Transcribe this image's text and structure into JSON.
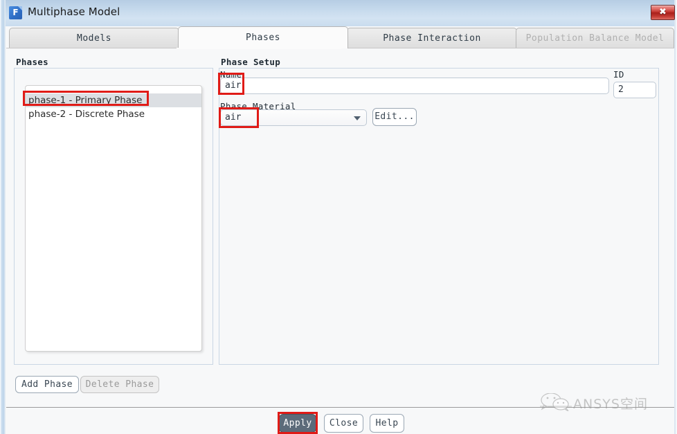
{
  "window": {
    "title": "Multiphase Model",
    "app_icon": "fluent-icon",
    "app_icon_letter": "F",
    "close_glyph": "✖",
    "accent_close": "#c0322b",
    "accent_titlebar": "#c5d9ec",
    "annotation_color": "#e01b17"
  },
  "tabs": [
    {
      "label": "Models",
      "state": "normal"
    },
    {
      "label": "Phases",
      "state": "active"
    },
    {
      "label": "Phase Interaction",
      "state": "normal"
    },
    {
      "label": "Population Balance Model",
      "state": "disabled"
    }
  ],
  "phases_panel": {
    "title": "Phases",
    "items": [
      {
        "label": "phase-1 - Primary Phase",
        "selected": true
      },
      {
        "label": "phase-2 - Discrete Phase",
        "selected": false
      }
    ],
    "add_button": "Add Phase",
    "delete_button": "Delete Phase"
  },
  "phase_setup": {
    "title": "Phase Setup",
    "name_label": "Name",
    "name_value": "air",
    "id_label": "ID",
    "id_value": "2",
    "material_label": "Phase Material",
    "material_value": "air",
    "material_arrow": "chevron-down-icon",
    "edit_button": "Edit..."
  },
  "footer": {
    "apply_button": "Apply",
    "close_button": "Close",
    "help_button": "Help"
  },
  "watermark": {
    "text": "ANSYS空间",
    "logo": "wechat-icon"
  }
}
